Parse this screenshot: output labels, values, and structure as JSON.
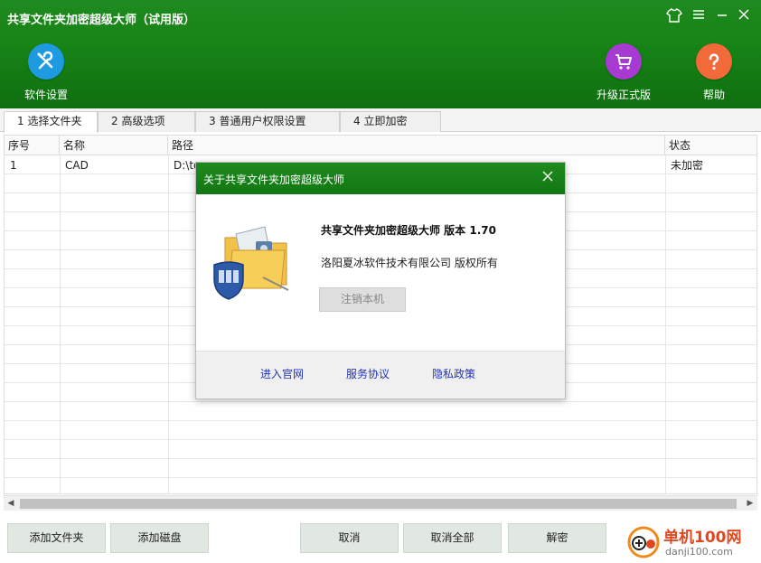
{
  "app": {
    "title": "共享文件夹加密超级大师（试用版）"
  },
  "toolbar": {
    "settings_label": "软件设置",
    "upgrade_label": "升级正式版",
    "help_label": "帮助"
  },
  "tabs": [
    {
      "label": "1 选择文件夹",
      "active": true
    },
    {
      "label": "2 高级选项",
      "active": false
    },
    {
      "label": "3 普通用户权限设置",
      "active": false
    },
    {
      "label": "4 立即加密",
      "active": false
    }
  ],
  "table": {
    "columns": [
      "序号",
      "名称",
      "路径",
      "状态"
    ],
    "rows": [
      {
        "index": "1",
        "name": "CAD",
        "path": "D:\\to",
        "status": "未加密"
      }
    ]
  },
  "buttons": {
    "add_folder": "添加文件夹",
    "add_disk": "添加磁盘",
    "cancel": "取消",
    "cancel_all": "取消全部",
    "decrypt": "解密"
  },
  "watermark": {
    "name": "单机100网",
    "url": "danji100.com"
  },
  "dialog": {
    "title": "关于共享文件夹加密超级大师",
    "product": "共享文件夹加密超级大师 版本 1.70",
    "copyright": "洛阳夏冰软件技术有限公司 版权所有",
    "unregister_label": "注销本机",
    "links": {
      "website": "进入官网",
      "service": "服务协议",
      "privacy": "隐私政策"
    }
  },
  "colors": {
    "header_green": "#178417",
    "settings_blue": "#1e9be0",
    "upgrade_purple": "#a63ad1",
    "help_orange": "#f26a3a",
    "link_blue": "#2233bb"
  }
}
